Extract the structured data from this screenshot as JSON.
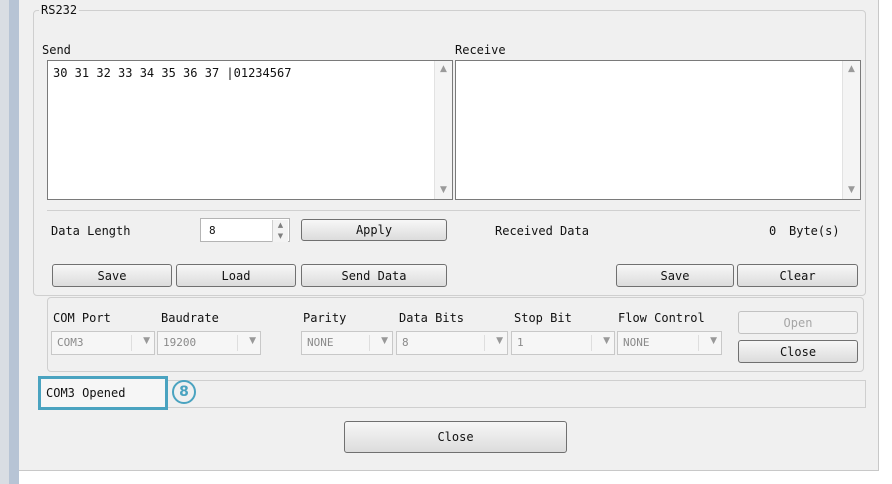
{
  "rs232": {
    "group_title": "RS232",
    "send_label": "Send",
    "receive_label": "Receive",
    "send_text": "30 31 32 33 34 35 36 37 |01234567",
    "receive_text": "",
    "data_length_label": "Data Length",
    "data_length_value": "8",
    "apply_label": "Apply",
    "received_data_label": "Received Data",
    "received_count": "0",
    "byte_unit": "Byte(s)",
    "send_buttons": [
      "Save",
      "Load",
      "Send Data"
    ],
    "receive_buttons": [
      "Save",
      "Clear"
    ]
  },
  "port": {
    "labels": [
      "COM Port",
      "Baudrate",
      "Parity",
      "Data Bits",
      "Stop Bit",
      "Flow Control"
    ],
    "values": [
      "COM3",
      "19200",
      "NONE",
      "8",
      "1",
      "NONE"
    ],
    "open_label": "Open",
    "close_label": "Close"
  },
  "status": {
    "text": "COM3 Opened",
    "callout_number": "8",
    "callout_color": "#4aa3c0"
  },
  "footer": {
    "close_label": "Close"
  }
}
